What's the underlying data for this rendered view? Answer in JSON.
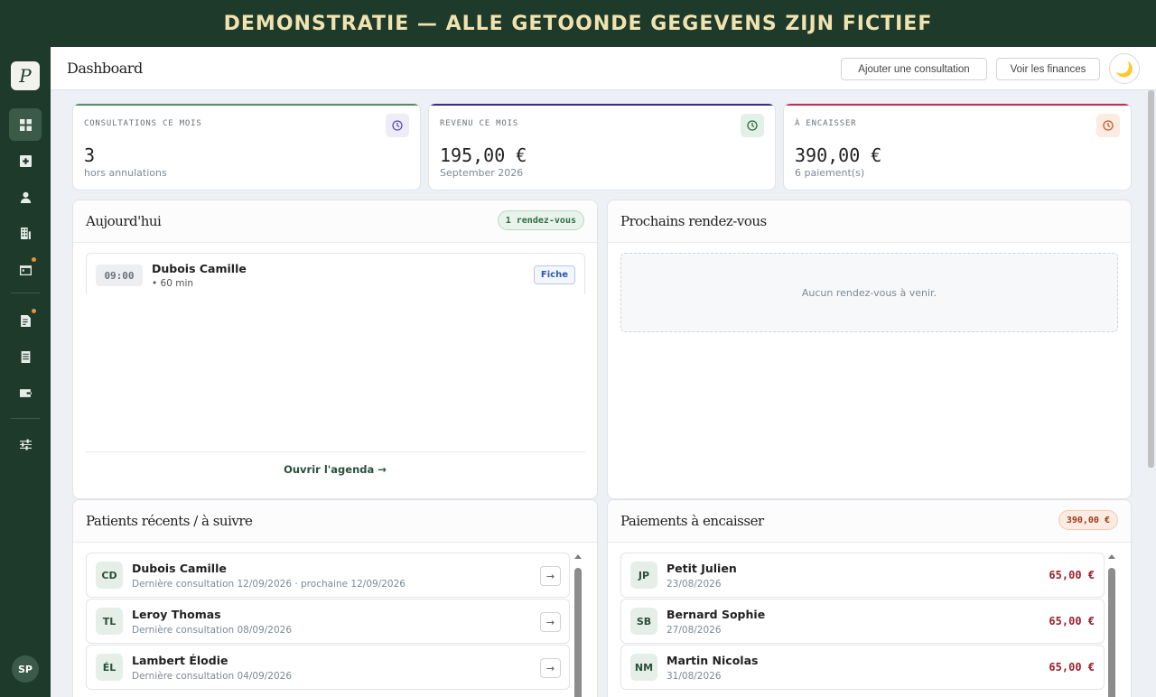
{
  "banner": {
    "text": "DEMONSTRATIE — ALLE GETOONDE GEGEVENS ZIJN FICTIEF"
  },
  "sidebar": {
    "logo_text": "P",
    "items": [
      {
        "icon": "grid-icon",
        "active": true,
        "dot": false
      },
      {
        "icon": "plus-square-icon",
        "active": false,
        "dot": false
      },
      {
        "icon": "person-icon",
        "active": false,
        "dot": false
      },
      {
        "icon": "building-icon",
        "active": false,
        "dot": false
      },
      {
        "icon": "calendar-icon",
        "active": false,
        "dot": true
      },
      {
        "icon": "document-edit-icon",
        "active": false,
        "dot": true
      },
      {
        "icon": "document-icon",
        "active": false,
        "dot": false
      },
      {
        "icon": "wallet-icon",
        "active": false,
        "dot": false
      },
      {
        "icon": "sliders-icon",
        "active": false,
        "dot": false
      }
    ],
    "user_initials": "SP"
  },
  "topbar": {
    "title": "Dashboard",
    "add_consultation": "Ajouter une consultation",
    "view_finances": "Voir les finances",
    "theme_icon": "🌙"
  },
  "stats": [
    {
      "label": "CONSULTATIONS CE MOIS",
      "value": "3",
      "sub": "hors annulations",
      "accent": "#5a8a6b",
      "icon_color": "#5a4fb0",
      "icon_bg": "#eeecf8"
    },
    {
      "label": "REVENU CE MOIS",
      "value": "195,00 €",
      "sub": "September 2026",
      "accent": "#3a2f8f",
      "icon_color": "#2f6b45",
      "icon_bg": "#e3f0e7"
    },
    {
      "label": "À ENCAISSER",
      "value": "390,00 €",
      "sub": "6 paiement(s)",
      "accent": "#c43050",
      "icon_color": "#c45a28",
      "icon_bg": "#fbebe0"
    }
  ],
  "today": {
    "title": "Aujourd'hui",
    "badge": "1 rendez-vous",
    "appointments": [
      {
        "time": "09:00",
        "name": "Dubois Camille",
        "duration": "• 60 min",
        "button": "Fiche"
      }
    ],
    "agenda_link": "Ouvrir l'agenda →"
  },
  "upcoming": {
    "title": "Prochains rendez-vous",
    "empty": "Aucun rendez-vous à venir."
  },
  "recent_patients": {
    "title": "Patients récents / à suivre",
    "rows": [
      {
        "initials": "CD",
        "name": "Dubois Camille",
        "sub": "Dernière consultation 12/09/2026 · prochaine 12/09/2026",
        "action": "→"
      },
      {
        "initials": "TL",
        "name": "Leroy Thomas",
        "sub": "Dernière consultation 08/09/2026",
        "action": "→"
      },
      {
        "initials": "ÉL",
        "name": "Lambert Élodie",
        "sub": "Dernière consultation 04/09/2026",
        "action": "→"
      }
    ]
  },
  "payments": {
    "title": "Paiements à encaisser",
    "badge": "390,00 €",
    "rows": [
      {
        "initials": "JP",
        "name": "Petit Julien",
        "date": "23/08/2026",
        "amount": "65,00 €"
      },
      {
        "initials": "SB",
        "name": "Bernard Sophie",
        "date": "27/08/2026",
        "amount": "65,00 €"
      },
      {
        "initials": "NM",
        "name": "Martin Nicolas",
        "date": "31/08/2026",
        "amount": "65,00 €"
      }
    ]
  }
}
